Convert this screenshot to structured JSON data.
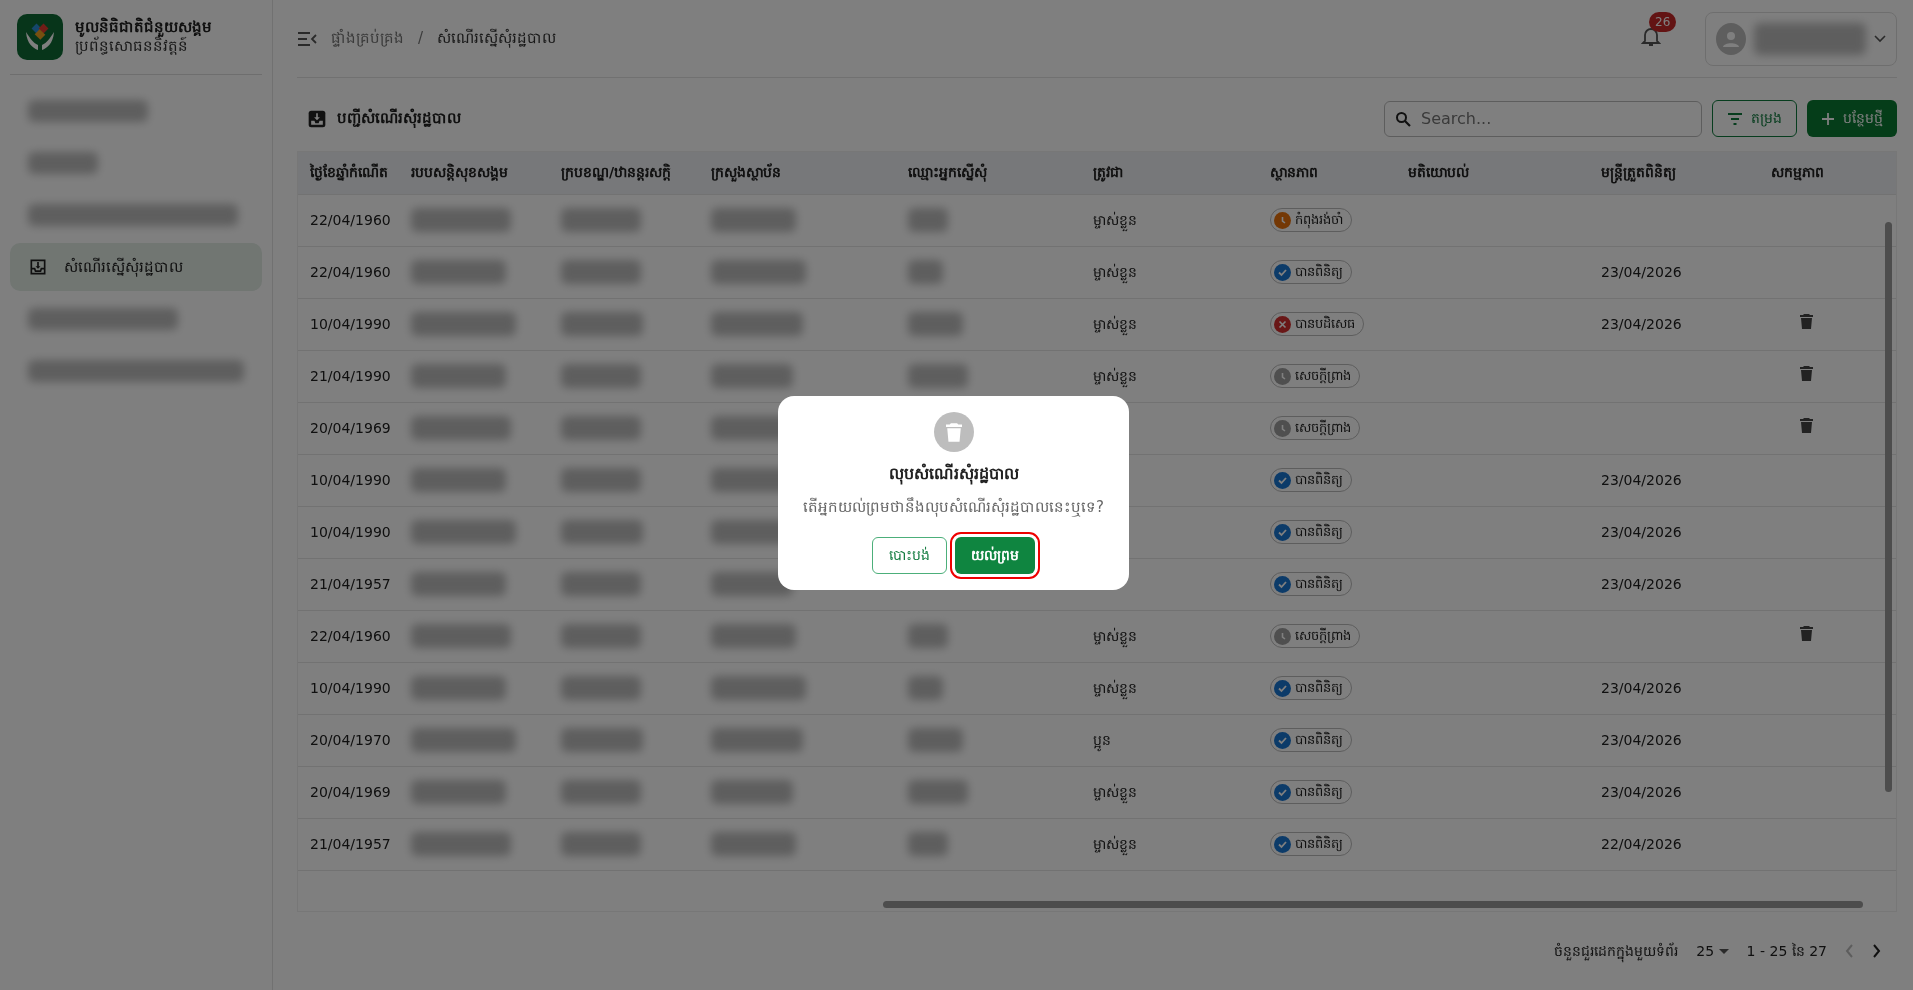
{
  "sidebar": {
    "brand_title": "មូលនិធិជាតិជំនួយសង្គម",
    "brand_subtitle": "ប្រព័ន្ធសោធននិវត្តន៍",
    "items": [
      {
        "kind": "redacted",
        "selected": false
      },
      {
        "kind": "redacted",
        "selected": false
      },
      {
        "kind": "redacted",
        "selected": false
      },
      {
        "kind": "link",
        "label": "សំណើរស្នើសុំរដ្ឋបាល",
        "selected": true
      },
      {
        "kind": "redacted",
        "selected": false
      },
      {
        "kind": "redacted",
        "selected": false
      }
    ]
  },
  "header": {
    "breadcrumb_separator": "/",
    "breadcrumbs": [
      "ផ្ទាំងគ្រប់គ្រង",
      "សំណើរស្នើសុំរដ្ឋបាល"
    ],
    "notification_count": "26"
  },
  "page": {
    "title": "បញ្ជីសំណើរសុំរដ្ឋបាល",
    "search": {
      "placeholder": "Search..."
    },
    "filter_button": "តម្រង",
    "add_button": "បន្ថែមថ្មី"
  },
  "table": {
    "columns": [
      "ថ្ងៃខែឆ្នាំកំណើត",
      "របបសន្តិសុខសង្គម",
      "ក្របខណ្ឌ/ឋានន្តរសក្តិ",
      "ក្រសួងស្ថាប័ន",
      "ឈ្មោះអ្នកស្នើសុំ",
      "ត្រូវជា",
      "ស្ថានភាព",
      "មតិយោបល់",
      "មន្ត្រីត្រួតពិនិត្យ",
      "សកម្មភាព"
    ],
    "rows": [
      {
        "birth_date": "22/04/1960",
        "relation": "ម្ចាស់ខ្លួន",
        "status": {
          "kind": "pending",
          "label": "កំពុងរង់ចាំ"
        },
        "deletable": false
      },
      {
        "birth_date": "22/04/1960",
        "relation": "ម្ចាស់ខ្លួន",
        "status": {
          "kind": "approved",
          "label": "បានពិនិត្យ"
        },
        "reviewed_on": "23/04/2026",
        "deletable": false
      },
      {
        "birth_date": "10/04/1990",
        "relation": "ម្ចាស់ខ្លួន",
        "status": {
          "kind": "rejected",
          "label": "បានបដិសេធ"
        },
        "reviewed_on": "23/04/2026",
        "deletable": true
      },
      {
        "birth_date": "21/04/1990",
        "relation": "ម្ចាស់ខ្លួន",
        "status": {
          "kind": "draft",
          "label": "សេចក្តីព្រាង"
        },
        "deletable": true
      },
      {
        "birth_date": "20/04/1969",
        "status": {
          "kind": "draft",
          "label": "សេចក្តីព្រាង"
        },
        "deletable": true
      },
      {
        "birth_date": "10/04/1990",
        "status": {
          "kind": "approved",
          "label": "បានពិនិត្យ"
        },
        "reviewed_on": "23/04/2026",
        "deletable": false
      },
      {
        "birth_date": "10/04/1990",
        "status": {
          "kind": "approved",
          "label": "បានពិនិត្យ"
        },
        "reviewed_on": "23/04/2026",
        "deletable": false
      },
      {
        "birth_date": "21/04/1957",
        "status": {
          "kind": "approved",
          "label": "បានពិនិត្យ"
        },
        "reviewed_on": "23/04/2026",
        "deletable": false
      },
      {
        "birth_date": "22/04/1960",
        "relation": "ម្ចាស់ខ្លួន",
        "status": {
          "kind": "draft",
          "label": "សេចក្តីព្រាង"
        },
        "deletable": true
      },
      {
        "birth_date": "10/04/1990",
        "relation": "ម្ចាស់ខ្លួន",
        "status": {
          "kind": "approved",
          "label": "បានពិនិត្យ"
        },
        "reviewed_on": "23/04/2026",
        "deletable": false
      },
      {
        "birth_date": "20/04/1970",
        "relation": "ប្អូន",
        "status": {
          "kind": "approved",
          "label": "បានពិនិត្យ"
        },
        "reviewed_on": "23/04/2026",
        "deletable": false
      },
      {
        "birth_date": "20/04/1969",
        "relation": "ម្ចាស់ខ្លួន",
        "status": {
          "kind": "approved",
          "label": "បានពិនិត្យ"
        },
        "reviewed_on": "23/04/2026",
        "deletable": false
      },
      {
        "birth_date": "21/04/1957",
        "relation": "ម្ចាស់ខ្លួន",
        "status": {
          "kind": "approved",
          "label": "បានពិនិត្យ"
        },
        "reviewed_on": "22/04/2026",
        "deletable": false
      }
    ]
  },
  "pagination": {
    "rows_per_page_label": "ចំនួនជួរដេកក្នុងមួយទំព័រ",
    "rows_per_page": "25",
    "range": "1 - 25 នៃ 27"
  },
  "dialog": {
    "title": "លុបសំណើរសុំរដ្ឋបាល",
    "message": "តើអ្នកយល់ព្រមថានឹងលុបសំណើរសុំរដ្ឋបាលនេះឬទេ?",
    "cancel": "បោះបង់",
    "confirm": "យល់ព្រម",
    "confirm_focused": true
  }
}
